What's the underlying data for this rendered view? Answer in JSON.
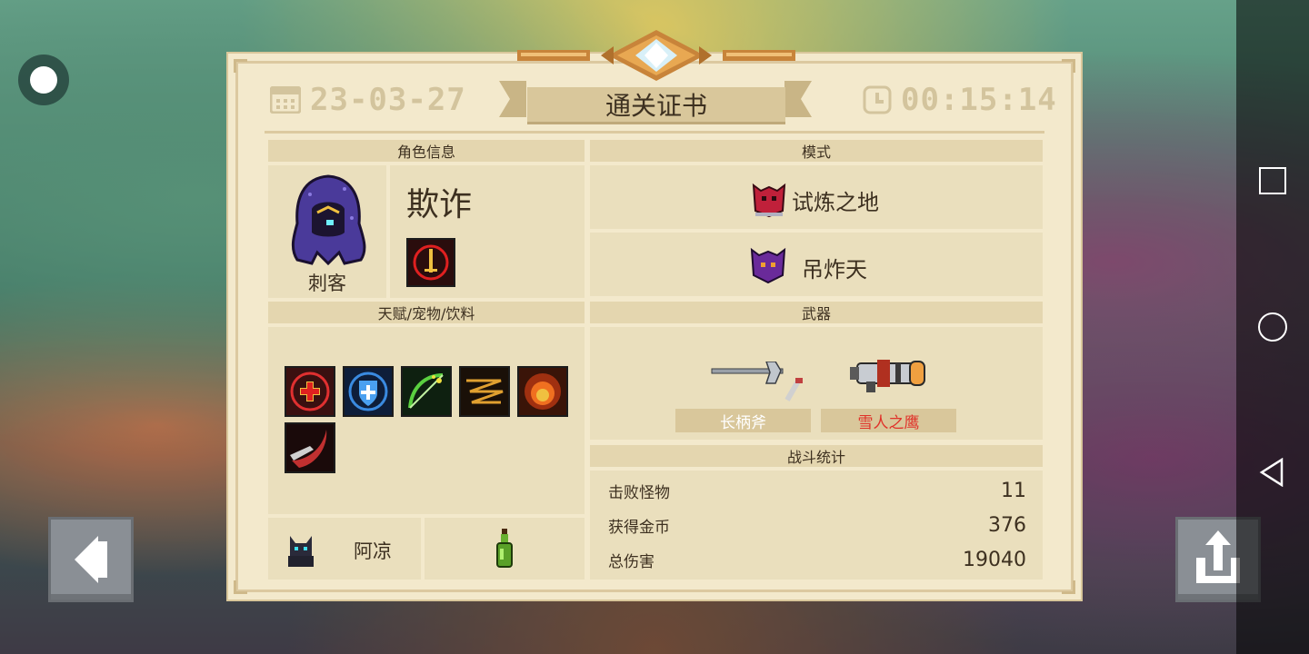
{
  "certificate": {
    "title": "通关证书",
    "date": "23-03-27",
    "time": "00:15:14"
  },
  "character": {
    "section_title": "角色信息",
    "class_name": "刺客",
    "skin_name": "欺诈"
  },
  "mode": {
    "section_title": "模式",
    "items": [
      "试炼之地",
      "吊炸天"
    ]
  },
  "buffs": {
    "section_title": "天赋/宠物/饮料",
    "pet_name": "阿凉"
  },
  "weapons": {
    "section_title": "武器",
    "items": [
      {
        "name": "长柄斧",
        "color": "#ffffff"
      },
      {
        "name": "雪人之鹰",
        "color": "#e0322a"
      }
    ]
  },
  "stats": {
    "section_title": "战斗统计",
    "rows": [
      {
        "label": "击败怪物",
        "value": "11"
      },
      {
        "label": "获得金币",
        "value": "376"
      },
      {
        "label": "总伤害",
        "value": "19040"
      }
    ]
  },
  "colors": {
    "accent": "#d9c79b",
    "paper": "#f3e9cc",
    "text": "#3d3020"
  }
}
